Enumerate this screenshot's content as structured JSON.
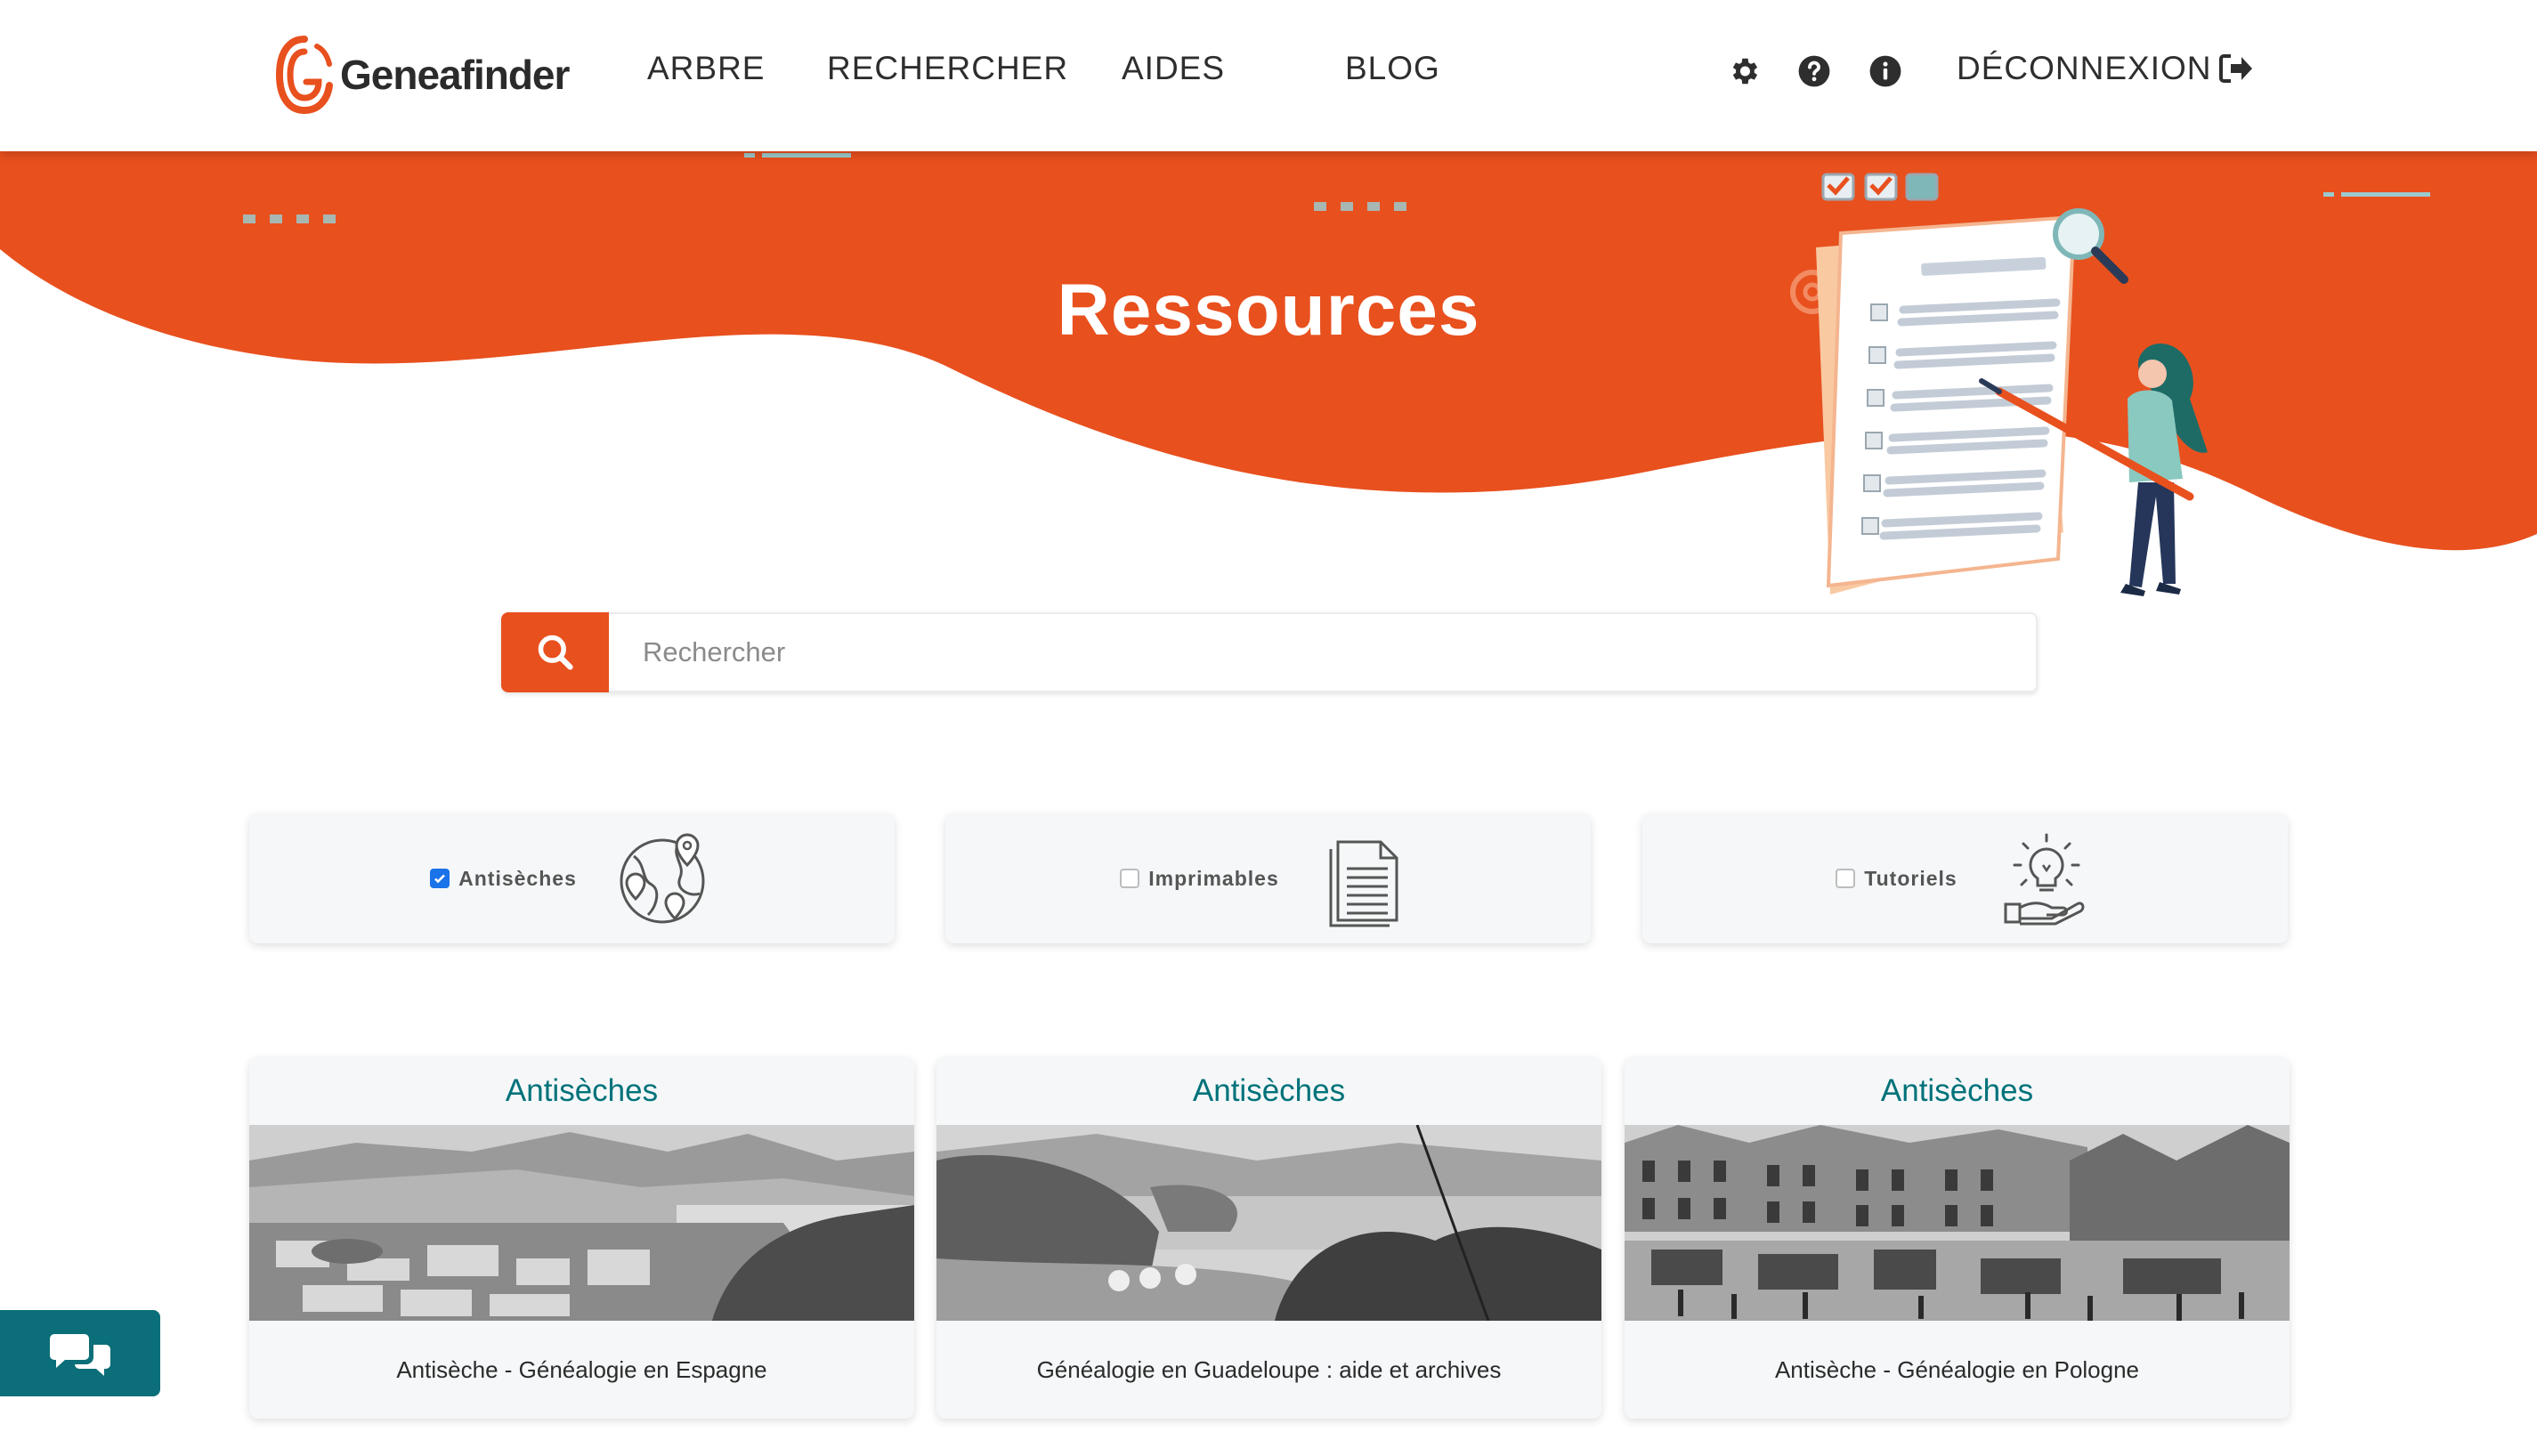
{
  "header": {
    "logo_text": "Geneafinder",
    "nav": [
      {
        "label": "ARBRE"
      },
      {
        "label": "RECHERCHER"
      },
      {
        "label": "AIDES"
      },
      {
        "label": "BLOG"
      }
    ],
    "icons": [
      "gear-icon",
      "help-icon",
      "info-icon"
    ],
    "logout_label": "DÉCONNEXION"
  },
  "hero": {
    "title": "Ressources"
  },
  "search": {
    "placeholder": "Rechercher"
  },
  "filters": [
    {
      "label": "Antisèches",
      "checked": true,
      "icon": "world-map-pins-icon"
    },
    {
      "label": "Imprimables",
      "checked": false,
      "icon": "document-icon"
    },
    {
      "label": "Tutoriels",
      "checked": false,
      "icon": "lightbulb-hand-icon"
    }
  ],
  "cards": [
    {
      "category": "Antisèches",
      "title": "Antisèche - Généalogie en Espagne"
    },
    {
      "category": "Antisèches",
      "title": "Généalogie en Guadeloupe : aide et archives"
    },
    {
      "category": "Antisèches",
      "title": "Antisèche - Généalogie en Pologne"
    }
  ],
  "colors": {
    "brand_orange": "#e8501e",
    "teal": "#00727a",
    "chat_bg": "#0b6e78"
  }
}
